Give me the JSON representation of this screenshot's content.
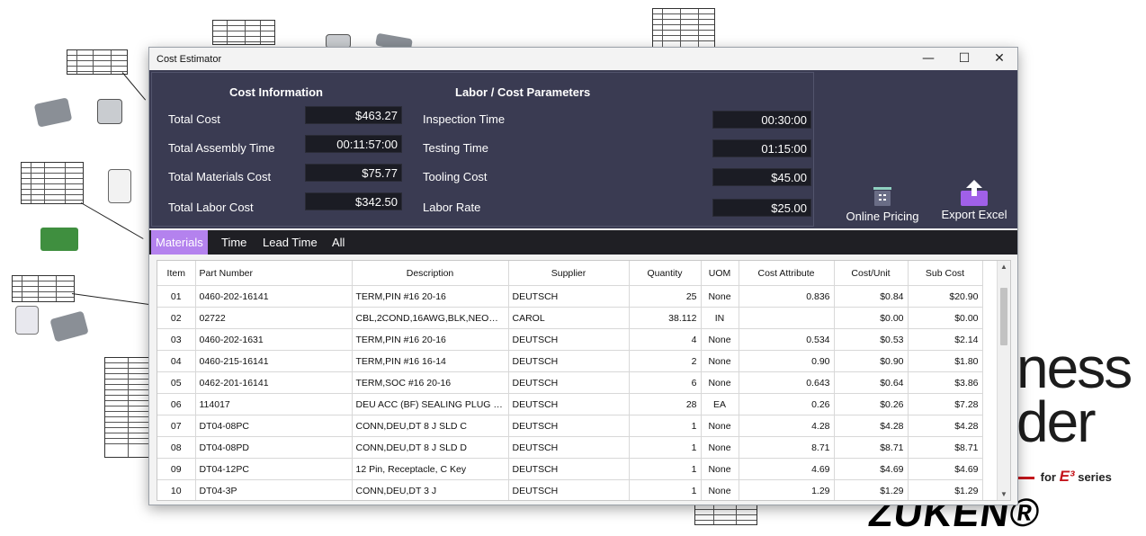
{
  "window": {
    "title": "Cost Estimator",
    "controls": {
      "minimize": "—",
      "maximize": "☐",
      "close": "✕"
    }
  },
  "cost_information": {
    "title": "Cost Information",
    "rows": [
      {
        "label": "Total Cost",
        "value": "$463.27"
      },
      {
        "label": "Total Assembly Time",
        "value": "00:11:57:00"
      },
      {
        "label": "Total Materials Cost",
        "value": "$75.77"
      },
      {
        "label": "Total Labor Cost",
        "value": "$342.50"
      }
    ]
  },
  "labor_parameters": {
    "title": "Labor / Cost Parameters",
    "rows": [
      {
        "label": "Inspection Time",
        "value": "00:30:00"
      },
      {
        "label": "Testing Time",
        "value": "01:15:00"
      },
      {
        "label": "Tooling Cost",
        "value": "$45.00"
      },
      {
        "label": "Labor Rate",
        "value": "$25.00"
      }
    ]
  },
  "actions": {
    "online_pricing": "Online Pricing",
    "export_excel": "Export Excel"
  },
  "tabs": [
    "Materials",
    "Time",
    "Lead Time",
    "All"
  ],
  "active_tab": "Materials",
  "table": {
    "columns": [
      "Item",
      "Part Number",
      "Description",
      "Supplier",
      "Quantity",
      "UOM",
      "Cost Attribute",
      "Cost/Unit",
      "Sub Cost"
    ],
    "rows": [
      [
        "01",
        "0460-202-16141",
        "TERM,PIN #16 20-16",
        "DEUTSCH",
        "25",
        "None",
        "0.836",
        "$0.84",
        "$20.90"
      ],
      [
        "02",
        "02722",
        "CBL,2COND,16AWG,BLK,NEOPRE...",
        "CAROL",
        "38.112",
        "IN",
        "",
        "$0.00",
        "$0.00"
      ],
      [
        "03",
        "0460-202-1631",
        "TERM,PIN #16 20-16",
        "DEUTSCH",
        "4",
        "None",
        "0.534",
        "$0.53",
        "$2.14"
      ],
      [
        "04",
        "0460-215-16141",
        "TERM,PIN #16 16-14",
        "DEUTSCH",
        "2",
        "None",
        "0.90",
        "$0.90",
        "$1.80"
      ],
      [
        "05",
        "0462-201-16141",
        "TERM,SOC #16 20-16",
        "DEUTSCH",
        "6",
        "None",
        "0.643",
        "$0.64",
        "$3.86"
      ],
      [
        "06",
        "114017",
        "DEU ACC (BF) SEALING PLUG 12...",
        "DEUTSCH",
        "28",
        "EA",
        "0.26",
        "$0.26",
        "$7.28"
      ],
      [
        "07",
        "DT04-08PC",
        "CONN,DEU,DT 8 J SLD C",
        "DEUTSCH",
        "1",
        "None",
        "4.28",
        "$4.28",
        "$4.28"
      ],
      [
        "08",
        "DT04-08PD",
        "CONN,DEU,DT 8 J SLD D",
        "DEUTSCH",
        "1",
        "None",
        "8.71",
        "$8.71",
        "$8.71"
      ],
      [
        "09",
        "DT04-12PC",
        "12 Pin, Receptacle, C Key",
        "DEUTSCH",
        "1",
        "None",
        "4.69",
        "$4.69",
        "$4.69"
      ],
      [
        "10",
        "DT04-3P",
        "CONN,DEU,DT 3 J",
        "DEUTSCH",
        "1",
        "None",
        "1.29",
        "$1.29",
        "$1.29"
      ]
    ]
  },
  "background": {
    "brand_line1": "ness",
    "brand_line2": "der",
    "brand_for": "for",
    "brand_e3": "E³",
    "brand_series": "series",
    "brand_logo": "ZUKEN®",
    "colors": {
      "panel": "#3a3b52",
      "tab_active": "#b482ee",
      "brand_red": "#c4161c"
    }
  }
}
